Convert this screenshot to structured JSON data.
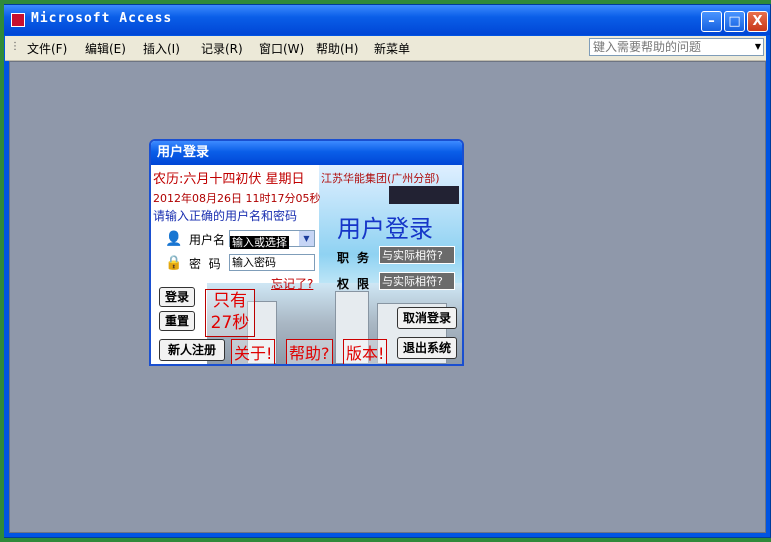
{
  "window": {
    "title": "Microsoft Access",
    "minimize_glyph": "–",
    "maximize_glyph": "□",
    "close_glyph": "X"
  },
  "menu": {
    "items": [
      "文件(F)",
      "编辑(E)",
      "插入(I)",
      "记录(R)",
      "窗口(W)",
      "帮助(H)",
      "新菜单"
    ],
    "help_placeholder": "键入需要帮助的问题"
  },
  "login": {
    "title": "用户登录",
    "marquee": "农历:六月十四初伏 星期日",
    "datetime": "2012年08月26日 11时17分05秒",
    "hint": "请输入正确的用户名和密码",
    "username_label": "用户名",
    "username_value": "输入或选择",
    "password_label": "密  码",
    "password_value": "输入密码",
    "forgot": "忘记了?",
    "company": "江苏华能集团(广州分部)",
    "big_title": "用户登录",
    "job_label": "职务",
    "job_value": "与实际相符?",
    "perm_label": "权限",
    "perm_value": "与实际相符?",
    "login_btn": "登录",
    "reset_btn": "重置",
    "register_btn": "新人注册",
    "countdown": "只有 27秒",
    "about_link": "关于!",
    "help_link": "帮助?",
    "version_link": "版本!",
    "cancel_btn": "取消登录",
    "exit_btn": "退出系统"
  },
  "colors": {
    "titlebar": "#0a5ee8",
    "workspace": "#8f98aa",
    "accent_red": "#e00000"
  }
}
